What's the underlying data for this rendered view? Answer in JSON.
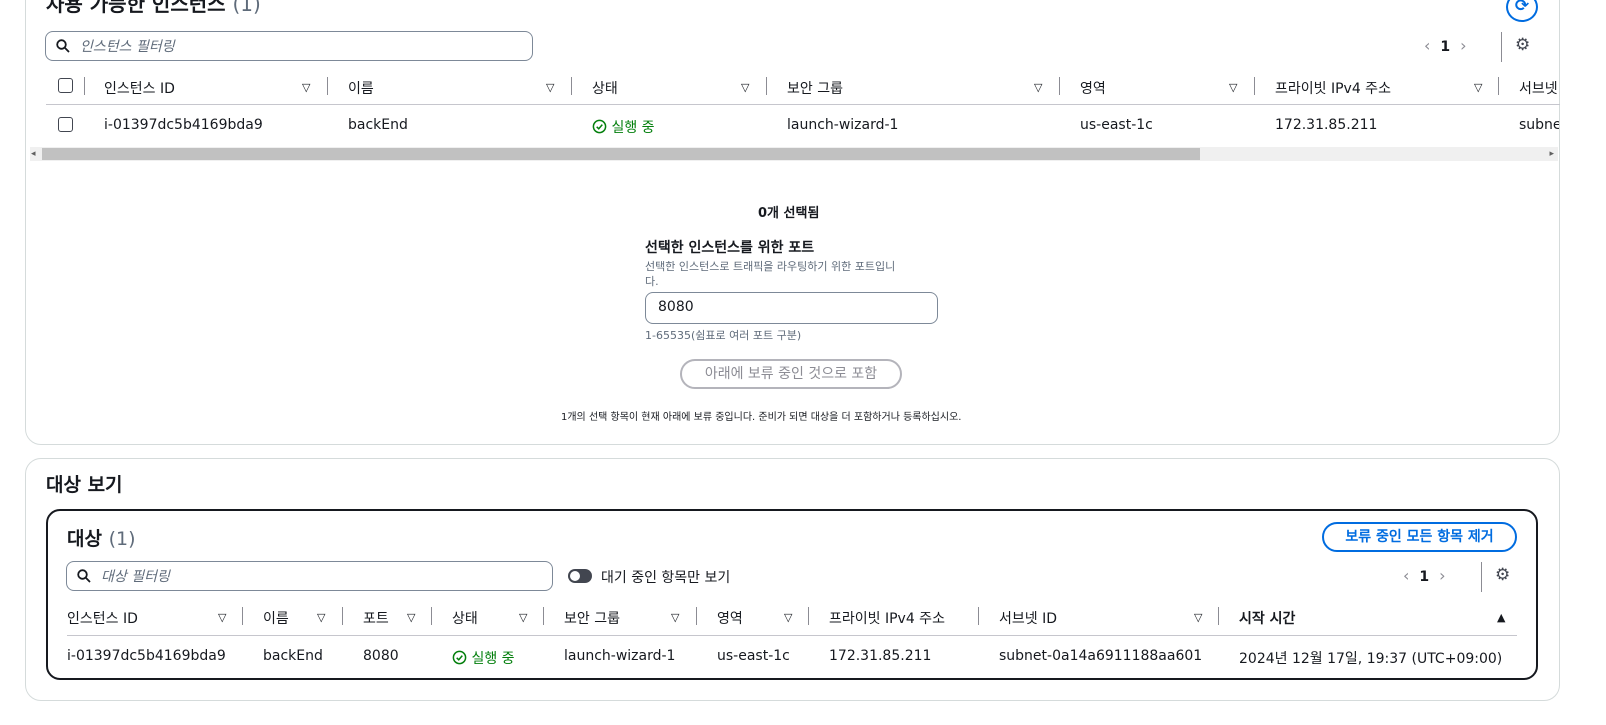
{
  "available": {
    "title": "사용 가능한 인스턴스",
    "count": "(1)",
    "filter_placeholder": "인스턴스 필터링",
    "page": "1",
    "columns": [
      "인스턴스 ID",
      "이름",
      "상태",
      "보안 그룹",
      "영역",
      "프라이빗 IPv4 주소",
      "서브넷"
    ],
    "row": {
      "instance_id": "i-01397dc5b4169bda9",
      "name": "backEnd",
      "status": "실행 중",
      "security_group": "launch-wizard-1",
      "zone": "us-east-1c",
      "private_ip": "172.31.85.211",
      "subnet": "subnet"
    }
  },
  "selection": {
    "selected_count": "0개 선택됨",
    "port_label": "선택한 인스턴스를 위한 포트",
    "port_desc_line1": "선택한 인스턴스로 트래픽을 라우팅하기 위한 포트입니",
    "port_desc_line2": "다.",
    "port_value": "8080",
    "port_hint": "1-65535(쉼표로 여러 포트 구분)",
    "include_button": "아래에 보류 중인 것으로 포함",
    "pending_note": "1개의 선택 항목이 현재 아래에 보류 중입니다. 준비가 되면 대상을 더 포함하거나 등록하십시오."
  },
  "review": {
    "title": "대상 보기",
    "targets_title": "대상",
    "targets_count": "(1)",
    "remove_all_button": "보류 중인 모든 항목 제거",
    "filter_placeholder": "대상 필터링",
    "pending_only_toggle": "대기 중인 항목만 보기",
    "page": "1",
    "columns": [
      "인스턴스 ID",
      "이름",
      "포트",
      "상태",
      "보안 그룹",
      "영역",
      "프라이빗 IPv4 주소",
      "서브넷 ID",
      "시작 시간"
    ],
    "row": {
      "instance_id": "i-01397dc5b4169bda9",
      "name": "backEnd",
      "port": "8080",
      "status": "실행 중",
      "security_group": "launch-wizard-1",
      "zone": "us-east-1c",
      "private_ip": "172.31.85.211",
      "subnet_id": "subnet-0a14a6911188aa601",
      "start_time": "2024년 12월 17일, 19:37 (UTC+09:00)"
    }
  },
  "colors": {
    "accent": "#006ce0",
    "success": "#037f0c",
    "text": "#16191f",
    "muted": "#5f6b7a"
  },
  "icons": [
    "search-icon",
    "settings-icon",
    "refresh-icon",
    "sort-icon",
    "sort-ascending-icon",
    "status-ok-icon",
    "chevron-left-icon",
    "chevron-right-icon"
  ]
}
